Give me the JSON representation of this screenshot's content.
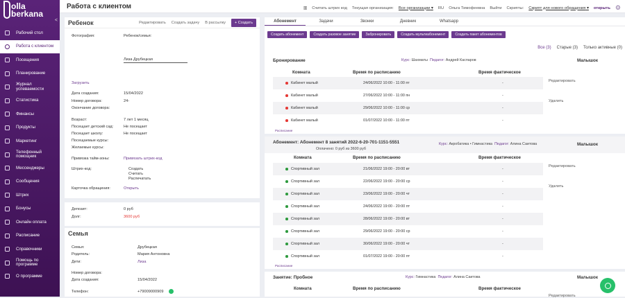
{
  "brand": {
    "line1": "olla",
    "line2": "berkana"
  },
  "nav": [
    {
      "label": "Рабочий стол",
      "icon": "desktop-icon"
    },
    {
      "label": "Работа с клиентом",
      "icon": "client-icon",
      "active": true
    },
    {
      "label": "Посещения",
      "icon": "visits-icon"
    },
    {
      "label": "Планирование",
      "icon": "planning-icon"
    },
    {
      "label": "Журнал успеваемости",
      "icon": "journal-icon"
    },
    {
      "label": "Статистика",
      "icon": "stats-icon"
    },
    {
      "label": "Финансы",
      "icon": "finance-icon"
    },
    {
      "label": "Продукты",
      "icon": "products-icon"
    },
    {
      "label": "Маркетинг",
      "icon": "marketing-icon"
    },
    {
      "label": "Телефонный помощник",
      "icon": "phone-icon"
    },
    {
      "label": "Мессенджеры",
      "icon": "messenger-icon"
    },
    {
      "label": "Сообщения",
      "icon": "messages-icon"
    },
    {
      "label": "Штрих",
      "icon": "barcode-icon"
    },
    {
      "label": "Бонусы",
      "icon": "bonus-icon"
    },
    {
      "label": "Онлайн оплата",
      "icon": "payment-icon"
    },
    {
      "label": "Расписание",
      "icon": "schedule-icon"
    },
    {
      "label": "Справочники",
      "icon": "reference-icon"
    },
    {
      "label": "Помощь по программе",
      "icon": "help-icon"
    },
    {
      "label": "О программе",
      "icon": "about-icon"
    }
  ],
  "topbar": {
    "title": "Работа с клиентом",
    "scan": "Считать штрих код",
    "org_label": "Текущая организация:",
    "org_value": "Все организации",
    "lang": "RU",
    "user": "Ольга Тимофеевна",
    "logout": "Выйти",
    "scripts_label": "Скрипты:",
    "script_value": "Скрипт для нового обращения",
    "open": "открыть"
  },
  "child": {
    "title": "Ребенок",
    "edit": "Редактировать",
    "task": "Создать задачу",
    "mail": "В рассылку",
    "create": "+ Создать",
    "photo": "Фотография:",
    "rel": "Ребенок/семья:",
    "name": "Лиза Друбецкая",
    "upload": "Загрузить",
    "created_l": "Дата создания:",
    "created_v": "15/04/2022",
    "contract_l": "Номер договора:",
    "contract_v": "24-",
    "end_l": "Окончание договора:",
    "age_l": "Возраст:",
    "age_v": "7 лет 1 месяц",
    "kg_l": "Посещает детский сад:",
    "kg_v": "Не посещает",
    "school_l": "Посещает школу:",
    "school_v": "Не посещает",
    "courses_l": "Посещаемые курсы:",
    "wish_l": "Желаемые курсы:",
    "tz_l": "Привязка тайм-зоны:",
    "tz_v": "Привязать штрих-код",
    "bc_l": "Штрих-код:",
    "bc1": "Создать",
    "bc2": "Считать",
    "bc3": "Распечатать",
    "card_l": "Карточка обращения:",
    "card_v": "Открыть"
  },
  "deposit": {
    "dep_l": "Депозит:",
    "dep_v": "0 руб",
    "debt_l": "Долг:",
    "debt_v": "3600 руб"
  },
  "family": {
    "title": "Семья",
    "fam_l": "Семья:",
    "fam_v": "Друбецкая",
    "par_l": "Родитель:",
    "par_v": "Мария Антоновна",
    "kids_l": "Дети:",
    "kids_v": "Лиза",
    "contract_l": "Номер договора:",
    "created_l": "Дата создания:",
    "created_v": "15/04/2022",
    "phone_l": "Телефон:",
    "phone_v": "+79009000909"
  },
  "tabs": [
    "Абонемент",
    "Задачи",
    "Звонки",
    "Дневник",
    "Whatsapp"
  ],
  "actions": [
    "Создать абонемент",
    "Создать разовое занятие",
    "Забронировать",
    "Создать мультиабонемент",
    "Создать пакет абонементов"
  ],
  "filters": {
    "all": "Все (3)",
    "old": "Старые (3)",
    "active": "Только активные (0)"
  },
  "cols": {
    "room": "Комната",
    "planned": "Время по расписанию",
    "actual": "Время фактическое",
    "kid": "Малышок"
  },
  "side": {
    "edit": "Редактировать",
    "del": "Удалить"
  },
  "schedule_link": "Расписание",
  "booking": {
    "title": "Бронирование",
    "course_l": "Курс:",
    "course_v": "Шахматы",
    "teacher_l": "Педагог:",
    "teacher_v": "Андрей Каспаров",
    "rows": [
      {
        "room": "Кабинет малый",
        "time": "24/06/2022 10:00 - 11:00 пт",
        "actual": "-"
      },
      {
        "room": "Кабинет малый",
        "time": "27/06/2022 10:00 - 11:00 пн",
        "actual": "-"
      },
      {
        "room": "Кабинет малый",
        "time": "29/06/2022 10:00 - 11:00 ср",
        "actual": "-"
      },
      {
        "room": "Кабинет малый",
        "time": "01/07/2022 10:00 - 11:00 пт",
        "actual": "-"
      }
    ]
  },
  "sub": {
    "title": "Абонемент: Абонемент 8 занятий 2022-6-20-701-1151-5551",
    "paid": "Оплачено: 0 руб из 3600 руб",
    "course_l": "Курс:",
    "course_v": "Акробатика • Гимнастика",
    "teacher_l": "Педагог:",
    "teacher_v": "Алина Саитова",
    "rows": [
      {
        "room": "Спортивный зал",
        "time": "21/06/2022 19:00 - 20:00 вт",
        "actual": "-"
      },
      {
        "room": "Спортивный зал",
        "time": "22/06/2022 19:00 - 20:00 ср",
        "actual": "-"
      },
      {
        "room": "Спортивный зал",
        "time": "23/06/2022 19:00 - 20:00 чт",
        "actual": "-"
      },
      {
        "room": "Спортивный зал",
        "time": "24/06/2022 19:00 - 20:00 пт",
        "actual": "-"
      },
      {
        "room": "Спортивный зал",
        "time": "28/06/2022 19:00 - 20:00 вт",
        "actual": "-"
      },
      {
        "room": "Спортивный зал",
        "time": "29/06/2022 19:00 - 20:00 ср",
        "actual": "-"
      },
      {
        "room": "Спортивный зал",
        "time": "30/06/2022 19:00 - 20:00 чт",
        "actual": "-"
      },
      {
        "room": "Спортивный зал",
        "time": "01/07/2022 19:00 - 20:00 пт",
        "actual": "-"
      }
    ]
  },
  "trial": {
    "title": "Занятие: Пробное",
    "course_l": "Курс:",
    "course_v": "Гимнастика",
    "teacher_l": "Педагог:",
    "teacher_v": "Алина Саитова"
  },
  "colors": {
    "accent": "#6c3a8f",
    "sidebar": "#4a1a64",
    "dot_red": "#e53935",
    "dot_green": "#2e9a3e",
    "whatsapp": "#27c06a"
  }
}
